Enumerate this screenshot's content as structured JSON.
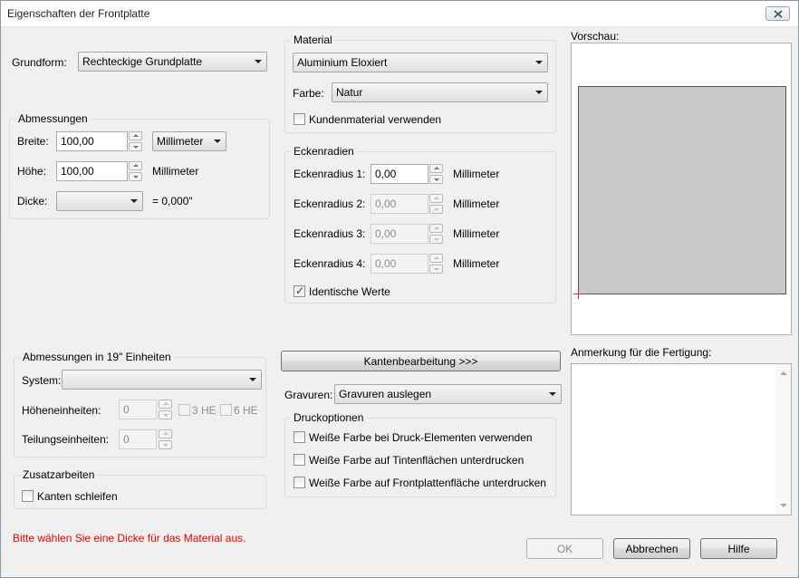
{
  "window": {
    "title": "Eigenschaften der Frontplatte"
  },
  "grundform": {
    "label": "Grundform:",
    "value": "Rechteckige Grundplatte"
  },
  "abmessungen": {
    "title": "Abmessungen",
    "breite_label": "Breite:",
    "breite_value": "100,00",
    "breite_unit": "Millimeter",
    "hoehe_label": "Höhe:",
    "hoehe_value": "100,00",
    "hoehe_unit": "Millimeter",
    "dicke_label": "Dicke:",
    "dicke_value": "",
    "dicke_result": "= 0,000\""
  },
  "material": {
    "title": "Material",
    "value": "Aluminium Eloxiert",
    "farbe_label": "Farbe:",
    "farbe_value": "Natur",
    "kunden_label": "Kundenmaterial verwenden",
    "kunden_checked": false
  },
  "eckenradien": {
    "title": "Eckenradien",
    "unit": "Millimeter",
    "items": [
      {
        "label": "Eckenradius 1:",
        "value": "0,00",
        "enabled": true
      },
      {
        "label": "Eckenradius 2:",
        "value": "0,00",
        "enabled": false
      },
      {
        "label": "Eckenradius 3:",
        "value": "0,00",
        "enabled": false
      },
      {
        "label": "Eckenradius 4:",
        "value": "0,00",
        "enabled": false
      }
    ],
    "identisch_label": "Identische Werte",
    "identisch_checked": true
  },
  "vorschau": {
    "title": "Vorschau:"
  },
  "einheiten19": {
    "title": "Abmessungen in 19\" Einheiten",
    "system_label": "System:",
    "system_value": "",
    "hoehe_label": "Höheneinheiten:",
    "hoehe_value": "0",
    "he3_label": "3 HE",
    "he6_label": "6 HE",
    "teilung_label": "Teilungseinheiten:",
    "teilung_value": "0"
  },
  "zusatz": {
    "title": "Zusatzarbeiten",
    "kanten_label": "Kanten schleifen"
  },
  "kanten_button": "Kantenbearbeitung >>>",
  "gravuren": {
    "label": "Gravuren:",
    "value": "Gravuren auslegen"
  },
  "druck": {
    "title": "Druckoptionen",
    "options": [
      "Weiße Farbe bei Druck-Elementen verwenden",
      "Weiße Farbe auf Tintenflächen unterdrucken",
      "Weiße Farbe auf Frontplattenfläche unterdrucken"
    ]
  },
  "anmerkung": {
    "title": "Anmerkung für die Fertigung:"
  },
  "status": {
    "error": "Bitte wählen Sie eine Dicke für das Material aus.",
    "error_color": "#e60000"
  },
  "buttons": {
    "ok": "OK",
    "abbrechen": "Abbrechen",
    "hilfe": "Hilfe"
  }
}
